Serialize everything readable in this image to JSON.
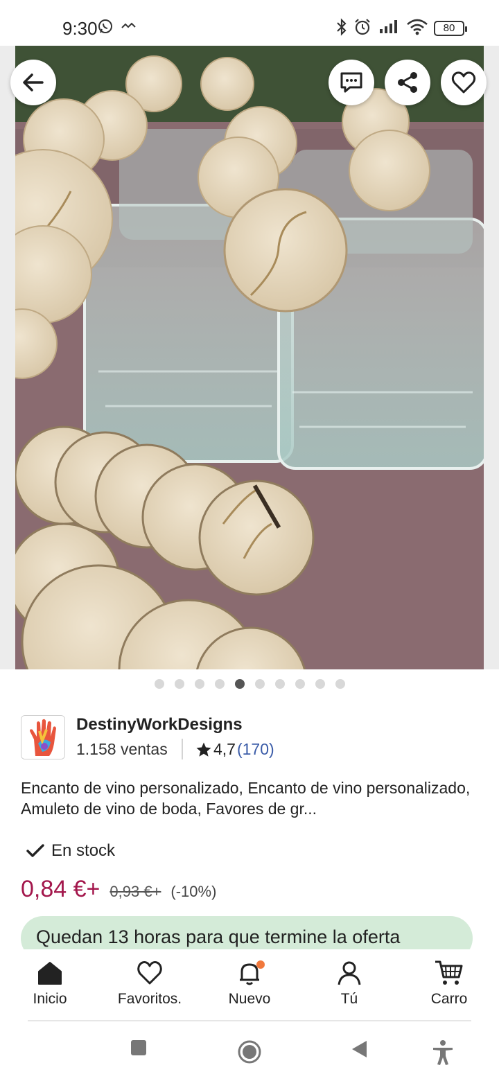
{
  "status_bar": {
    "time": "9:30",
    "battery": "80",
    "icons": [
      "whatsapp-icon",
      "signal-off-icon",
      "bluetooth-icon",
      "alarm-icon",
      "cell-signal-icon",
      "wifi-icon",
      "battery-icon"
    ]
  },
  "hero": {
    "image_alt": "Etiquetas de madera redondas con nombres grabados en vasos de cristal",
    "buttons": [
      "back-icon",
      "message-icon",
      "share-icon",
      "heart-icon"
    ],
    "carousel": {
      "total": 10,
      "active": 5
    }
  },
  "seller": {
    "name": "DestinyWorkDesigns",
    "sales": "1.158 ventas",
    "rating": "4,7",
    "reviews": "(170)"
  },
  "listing": {
    "title": "Encanto de vino personalizado, Encanto de vino personalizado, Amuleto de vino de boda, Favores de gr...",
    "stock": "En stock",
    "price": "0,84 €+",
    "old_price": "0,93 €+",
    "discount": "(-10%)",
    "offer": "Quedan 13 horas para que termine la oferta"
  },
  "bottom_nav": {
    "items": [
      {
        "label": "Inicio",
        "icon": "home-icon"
      },
      {
        "label": "Favoritos.",
        "icon": "heart-outline-icon"
      },
      {
        "label": "Nuevo",
        "icon": "bell-icon"
      },
      {
        "label": "Tú",
        "icon": "person-icon"
      },
      {
        "label": "Carro",
        "icon": "cart-icon"
      }
    ]
  },
  "system_nav": [
    "recents-button",
    "home-button",
    "back-button",
    "accessibility-button"
  ],
  "colors": {
    "price": "#a3174c",
    "offer_bg": "#d4ebd8",
    "link": "#3b5ca8",
    "notification": "#f1783c"
  }
}
